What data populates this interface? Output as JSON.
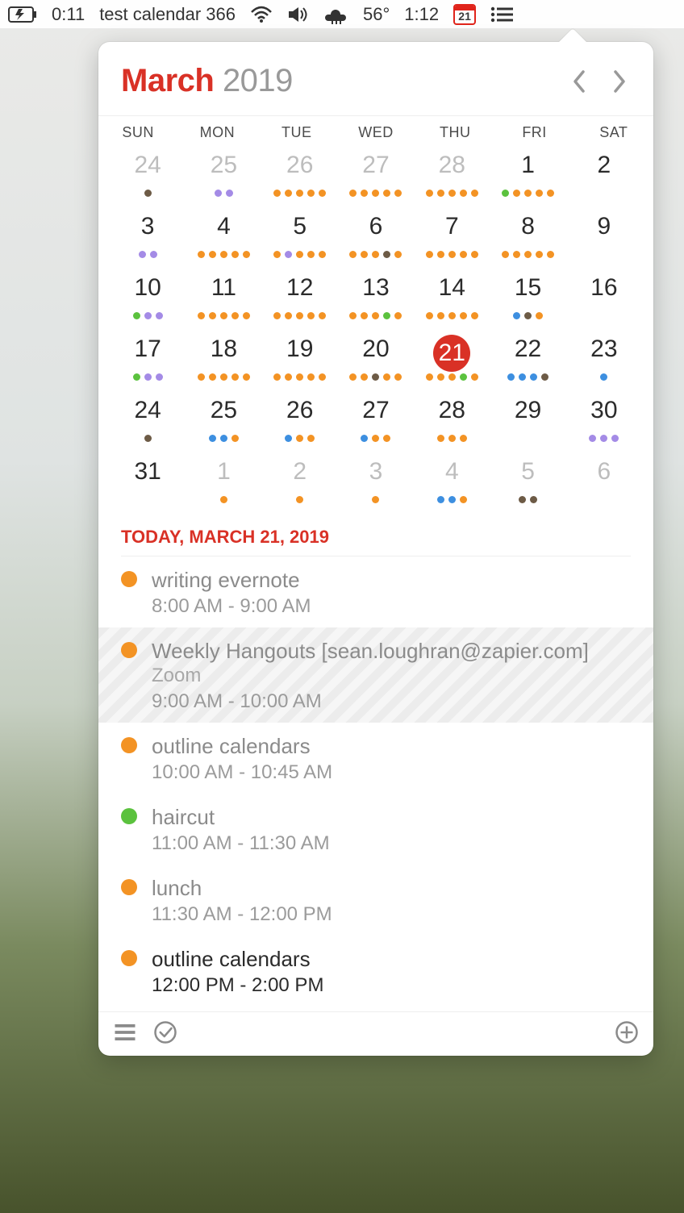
{
  "menubar": {
    "countdown": "0:11",
    "event_label": "test calendar 366",
    "temperature": "56°",
    "clock": "1:12",
    "cal_day": "21"
  },
  "colors": {
    "orange": "#f39324",
    "green": "#5bc23e",
    "purple": "#a48be6",
    "brown": "#6d5b46",
    "blue": "#3d8fe0",
    "accent": "#d93126"
  },
  "header": {
    "month": "March",
    "year": "2019"
  },
  "day_headers": [
    "SUN",
    "MON",
    "TUE",
    "WED",
    "THU",
    "FRI",
    "SAT"
  ],
  "grid": [
    {
      "n": "24",
      "other": true,
      "dots": [
        "brown"
      ]
    },
    {
      "n": "25",
      "other": true,
      "dots": [
        "purple",
        "purple"
      ]
    },
    {
      "n": "26",
      "other": true,
      "dots": [
        "orange",
        "orange",
        "orange",
        "orange",
        "orange"
      ]
    },
    {
      "n": "27",
      "other": true,
      "dots": [
        "orange",
        "orange",
        "orange",
        "orange",
        "orange"
      ]
    },
    {
      "n": "28",
      "other": true,
      "dots": [
        "orange",
        "orange",
        "orange",
        "orange",
        "orange"
      ]
    },
    {
      "n": "1",
      "dots": [
        "green",
        "orange",
        "orange",
        "orange",
        "orange"
      ]
    },
    {
      "n": "2",
      "dots": []
    },
    {
      "n": "3",
      "dots": [
        "purple",
        "purple"
      ]
    },
    {
      "n": "4",
      "dots": [
        "orange",
        "orange",
        "orange",
        "orange",
        "orange"
      ]
    },
    {
      "n": "5",
      "dots": [
        "orange",
        "purple",
        "orange",
        "orange",
        "orange"
      ]
    },
    {
      "n": "6",
      "dots": [
        "orange",
        "orange",
        "orange",
        "brown",
        "orange"
      ]
    },
    {
      "n": "7",
      "dots": [
        "orange",
        "orange",
        "orange",
        "orange",
        "orange"
      ]
    },
    {
      "n": "8",
      "dots": [
        "orange",
        "orange",
        "orange",
        "orange",
        "orange"
      ]
    },
    {
      "n": "9",
      "dots": []
    },
    {
      "n": "10",
      "dots": [
        "green",
        "purple",
        "purple"
      ]
    },
    {
      "n": "11",
      "dots": [
        "orange",
        "orange",
        "orange",
        "orange",
        "orange"
      ]
    },
    {
      "n": "12",
      "dots": [
        "orange",
        "orange",
        "orange",
        "orange",
        "orange"
      ]
    },
    {
      "n": "13",
      "dots": [
        "orange",
        "orange",
        "orange",
        "green",
        "orange"
      ]
    },
    {
      "n": "14",
      "dots": [
        "orange",
        "orange",
        "orange",
        "orange",
        "orange"
      ]
    },
    {
      "n": "15",
      "dots": [
        "blue",
        "brown",
        "orange"
      ]
    },
    {
      "n": "16",
      "dots": []
    },
    {
      "n": "17",
      "dots": [
        "green",
        "purple",
        "purple"
      ]
    },
    {
      "n": "18",
      "dots": [
        "orange",
        "orange",
        "orange",
        "orange",
        "orange"
      ]
    },
    {
      "n": "19",
      "dots": [
        "orange",
        "orange",
        "orange",
        "orange",
        "orange"
      ]
    },
    {
      "n": "20",
      "dots": [
        "orange",
        "orange",
        "brown",
        "orange",
        "orange"
      ]
    },
    {
      "n": "21",
      "today": true,
      "dots": [
        "orange",
        "orange",
        "orange",
        "green",
        "orange"
      ]
    },
    {
      "n": "22",
      "dots": [
        "blue",
        "blue",
        "blue",
        "brown"
      ]
    },
    {
      "n": "23",
      "dots": [
        "blue"
      ]
    },
    {
      "n": "24",
      "dots": [
        "brown"
      ]
    },
    {
      "n": "25",
      "dots": [
        "blue",
        "blue",
        "orange"
      ]
    },
    {
      "n": "26",
      "dots": [
        "blue",
        "orange",
        "orange"
      ]
    },
    {
      "n": "27",
      "dots": [
        "blue",
        "orange",
        "orange"
      ]
    },
    {
      "n": "28",
      "dots": [
        "orange",
        "orange",
        "orange"
      ]
    },
    {
      "n": "29",
      "dots": []
    },
    {
      "n": "30",
      "dots": [
        "purple",
        "purple",
        "purple"
      ]
    },
    {
      "n": "31",
      "dots": []
    },
    {
      "n": "1",
      "other": true,
      "dots": [
        "orange"
      ]
    },
    {
      "n": "2",
      "other": true,
      "dots": [
        "orange"
      ]
    },
    {
      "n": "3",
      "other": true,
      "dots": [
        "orange"
      ]
    },
    {
      "n": "4",
      "other": true,
      "dots": [
        "blue",
        "blue",
        "orange"
      ]
    },
    {
      "n": "5",
      "other": true,
      "dots": [
        "brown",
        "brown"
      ]
    },
    {
      "n": "6",
      "other": true,
      "dots": []
    }
  ],
  "events_header": "TODAY, MARCH 21, 2019",
  "events": [
    {
      "color": "orange",
      "title": "writing evernote",
      "time": "8:00 AM - 9:00 AM"
    },
    {
      "color": "orange",
      "title": "Weekly Hangouts [sean.loughran@zapier.com]",
      "sub": "Zoom",
      "time": "9:00 AM - 10:00 AM",
      "striped": true
    },
    {
      "color": "orange",
      "title": "outline calendars",
      "time": "10:00 AM - 10:45 AM"
    },
    {
      "color": "green",
      "title": "haircut",
      "time": "11:00 AM - 11:30 AM"
    },
    {
      "color": "orange",
      "title": "lunch",
      "time": "11:30 AM - 12:00 PM"
    },
    {
      "color": "orange",
      "title": "outline calendars",
      "time": "12:00 PM - 2:00 PM",
      "active": true
    }
  ]
}
